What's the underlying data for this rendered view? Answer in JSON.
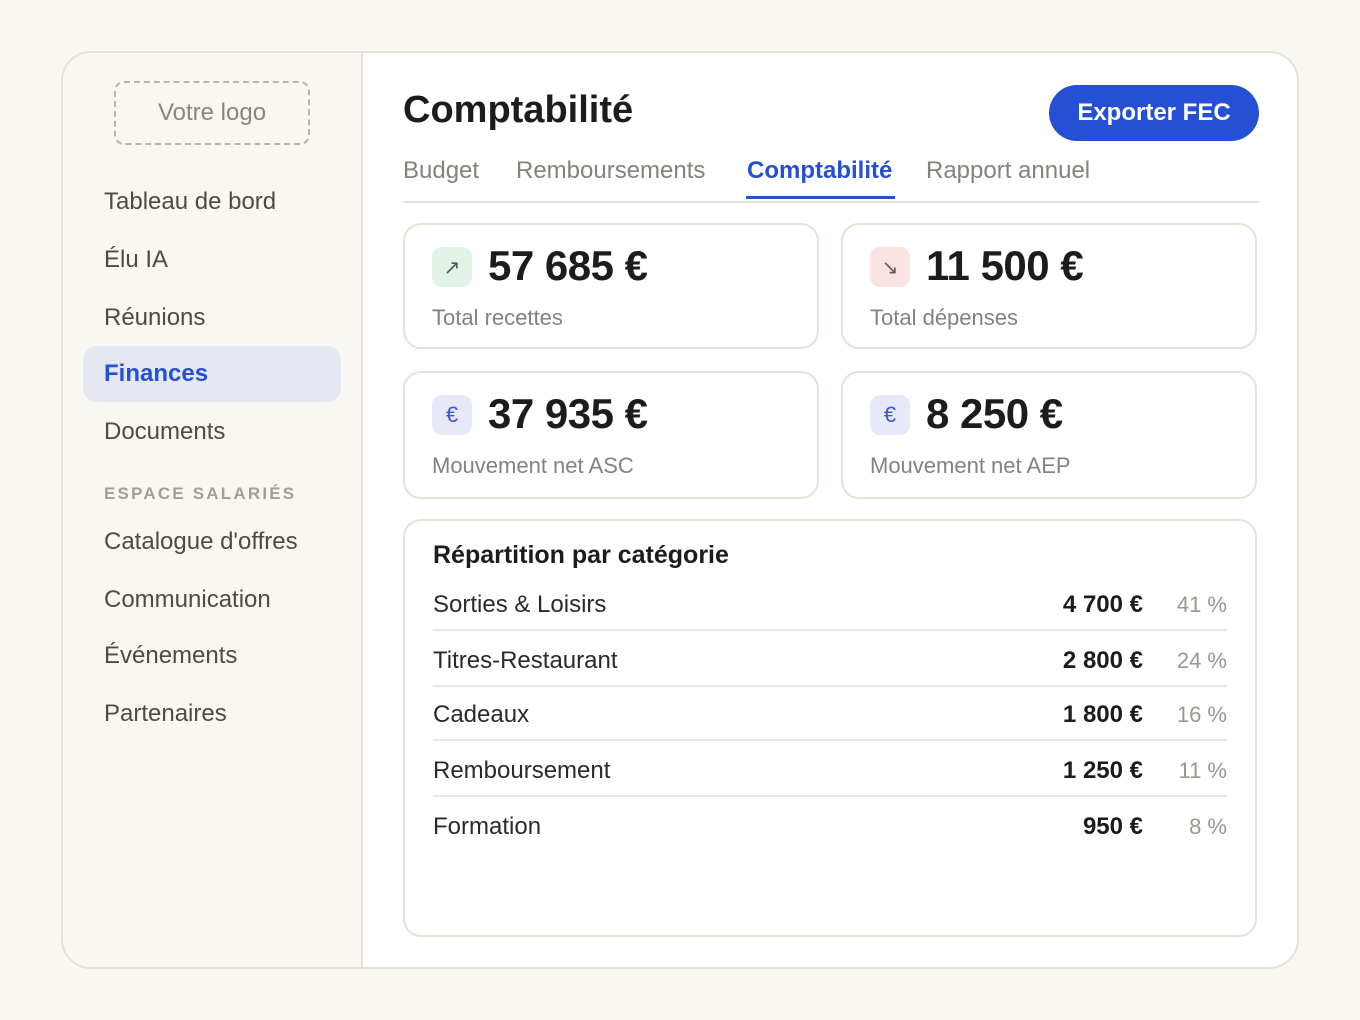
{
  "sidebar": {
    "logo": "Votre logo",
    "items": [
      {
        "label": "Tableau de bord"
      },
      {
        "label": "Élu IA"
      },
      {
        "label": "Réunions"
      },
      {
        "label": "Finances"
      },
      {
        "label": "Documents"
      }
    ],
    "section_label": "ESPACE SALARIÉS",
    "section_items": [
      {
        "label": "Catalogue d'offres"
      },
      {
        "label": "Communication"
      },
      {
        "label": "Événements"
      },
      {
        "label": "Partenaires"
      }
    ]
  },
  "header": {
    "title": "Comptabilité",
    "export_label": "Exporter FEC"
  },
  "tabs": [
    {
      "label": "Budget"
    },
    {
      "label": "Remboursements"
    },
    {
      "label": "Comptabilité"
    },
    {
      "label": "Rapport annuel"
    }
  ],
  "stats": [
    {
      "icon": "↗",
      "value": "57 685 €",
      "label": "Total recettes"
    },
    {
      "icon": "↘",
      "value": "11 500 €",
      "label": "Total dépenses"
    },
    {
      "icon": "€",
      "value": "37 935 €",
      "label": "Mouvement net ASC"
    },
    {
      "icon": "€",
      "value": "8 250 €",
      "label": "Mouvement net AEP"
    }
  ],
  "breakdown": {
    "title": "Répartition par catégorie",
    "rows": [
      {
        "label": "Sorties & Loisirs",
        "amount": "4 700 €",
        "pct": "41 %"
      },
      {
        "label": "Titres-Restaurant",
        "amount": "2 800 €",
        "pct": "24 %"
      },
      {
        "label": "Cadeaux",
        "amount": "1 800 €",
        "pct": "16 %"
      },
      {
        "label": "Remboursement",
        "amount": "1 250 €",
        "pct": "11 %"
      },
      {
        "label": "Formation",
        "amount": "950 €",
        "pct": "8 %"
      }
    ]
  },
  "colors": {
    "accent": "#2550d6",
    "background": "#f8f7f2",
    "border": "#e6e3d6"
  }
}
